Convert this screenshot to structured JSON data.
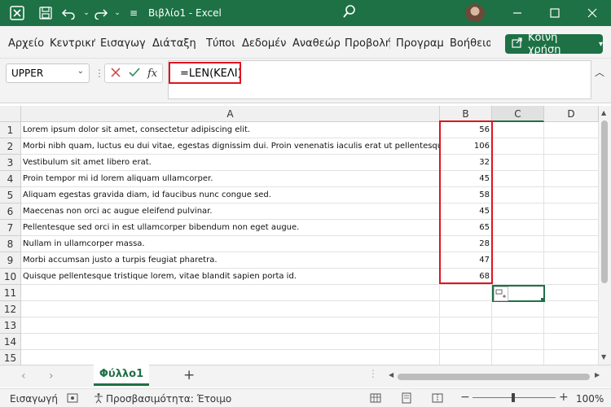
{
  "title": {
    "text": "Βιβλίο1  -  Excel"
  },
  "ribbon": {
    "tabs": [
      "Αρχείο",
      "Κεντρική",
      "Εισαγωγή",
      "Διάταξη σελίδας",
      "Τύποι",
      "Δεδομένα",
      "Αναθεώρηση",
      "Προβολή",
      "Προγραμματιστής",
      "Βοήθεια"
    ],
    "share_label": "Κοινή χρήση"
  },
  "formula_bar": {
    "name_box": "UPPER",
    "fx": "fx",
    "formula": "=LEN(ΚΕΛΙ)"
  },
  "columns": [
    "A",
    "B",
    "C",
    "D"
  ],
  "rows": [
    {
      "n": "1",
      "a": "Lorem ipsum dolor sit amet, consectetur adipiscing elit.",
      "b": "56"
    },
    {
      "n": "2",
      "a": "Morbi nibh quam, luctus eu dui vitae, egestas dignissim dui. Proin venenatis iaculis erat ut pellentesque.",
      "b": "106"
    },
    {
      "n": "3",
      "a": "Vestibulum sit amet libero erat.",
      "b": "32"
    },
    {
      "n": "4",
      "a": "Proin tempor mi id lorem aliquam ullamcorper.",
      "b": "45"
    },
    {
      "n": "5",
      "a": "Aliquam egestas gravida diam, id faucibus nunc congue sed.",
      "b": "58"
    },
    {
      "n": "6",
      "a": "Maecenas non orci ac augue eleifend pulvinar.",
      "b": "45"
    },
    {
      "n": "7",
      "a": "Pellentesque sed orci in est ullamcorper bibendum non eget augue.",
      "b": "65"
    },
    {
      "n": "8",
      "a": "Nullam in ullamcorper massa.",
      "b": "28"
    },
    {
      "n": "9",
      "a": "Morbi accumsan justo a turpis feugiat pharetra.",
      "b": "47"
    },
    {
      "n": "10",
      "a": "Quisque pellentesque tristique lorem, vitae blandit sapien porta id.",
      "b": "68"
    },
    {
      "n": "11",
      "a": "",
      "b": ""
    },
    {
      "n": "12",
      "a": "",
      "b": ""
    },
    {
      "n": "13",
      "a": "",
      "b": ""
    },
    {
      "n": "14",
      "a": "",
      "b": ""
    },
    {
      "n": "15",
      "a": "",
      "b": ""
    }
  ],
  "sheet": {
    "tab": "Φύλλο1"
  },
  "status": {
    "mode": "Εισαγωγή",
    "accessibility": "Προσβασιμότητα: Έτοιμο",
    "zoom": "100%"
  },
  "colors": {
    "accent": "#1e7145",
    "highlight": "#e0141e"
  }
}
